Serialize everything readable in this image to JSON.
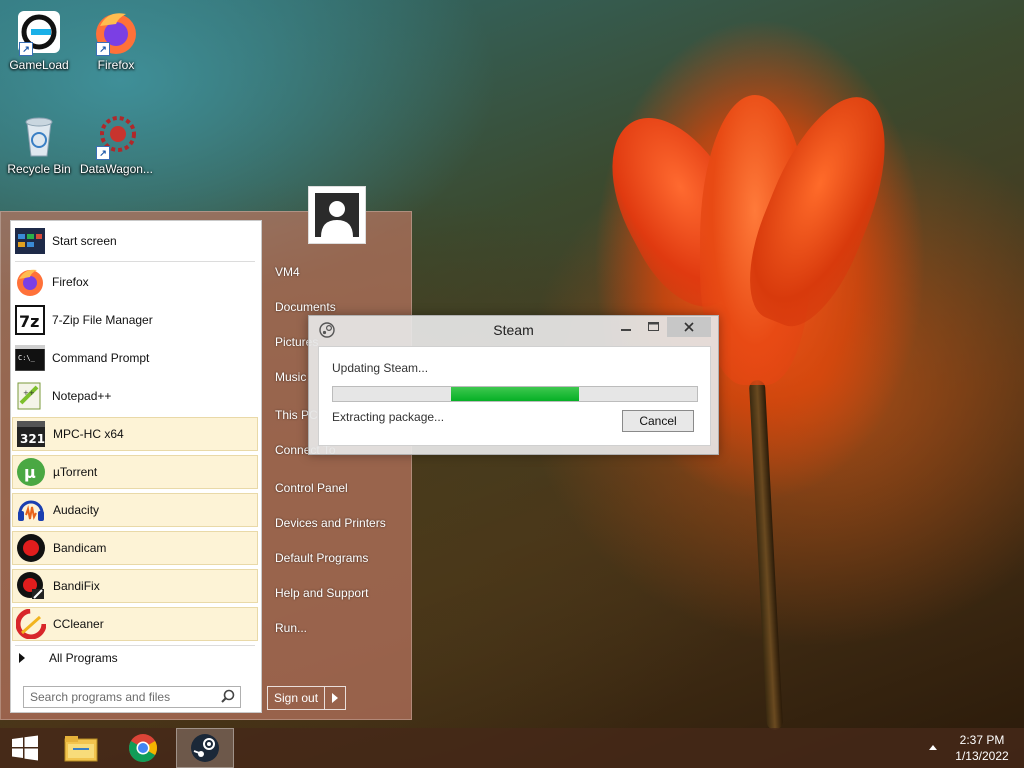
{
  "desktop": {
    "icons": [
      {
        "label": "GameLoad"
      },
      {
        "label": "Firefox"
      },
      {
        "label": "Recycle Bin"
      },
      {
        "label": "DataWagon..."
      }
    ]
  },
  "start_menu": {
    "programs": [
      {
        "label": "Start screen",
        "icon": "start-screen-icon"
      },
      {
        "label": "Firefox",
        "icon": "firefox-icon"
      },
      {
        "label": "7-Zip File Manager",
        "icon": "7zip-icon"
      },
      {
        "label": "Command Prompt",
        "icon": "command-prompt-icon"
      },
      {
        "label": "Notepad++",
        "icon": "notepadpp-icon"
      },
      {
        "label": "MPC-HC x64",
        "icon": "mpc-hc-icon"
      },
      {
        "label": "µTorrent",
        "icon": "utorrent-icon"
      },
      {
        "label": "Audacity",
        "icon": "audacity-icon"
      },
      {
        "label": "Bandicam",
        "icon": "bandicam-icon"
      },
      {
        "label": "BandiFix",
        "icon": "bandifix-icon"
      },
      {
        "label": "CCleaner",
        "icon": "ccleaner-icon"
      }
    ],
    "all_programs": "All Programs",
    "search_placeholder": "Search programs and files",
    "right_items": [
      {
        "label": "VM4"
      },
      {
        "label": "Documents"
      },
      {
        "label": "Pictures"
      },
      {
        "label": "Music"
      },
      {
        "label": "This PC"
      },
      {
        "label": "Connect To"
      },
      {
        "label": "Control Panel"
      },
      {
        "label": "Devices and Printers"
      },
      {
        "label": "Default Programs"
      },
      {
        "label": "Help and Support"
      },
      {
        "label": "Run..."
      }
    ],
    "sign_out": "Sign out"
  },
  "steam_dialog": {
    "title": "Steam",
    "status": "Updating Steam...",
    "substatus": "Extracting package...",
    "cancel": "Cancel",
    "progress_start": 0.325,
    "progress_end": 0.675
  },
  "taskbar": {
    "time": "2:37 PM",
    "date": "1/13/2022"
  }
}
